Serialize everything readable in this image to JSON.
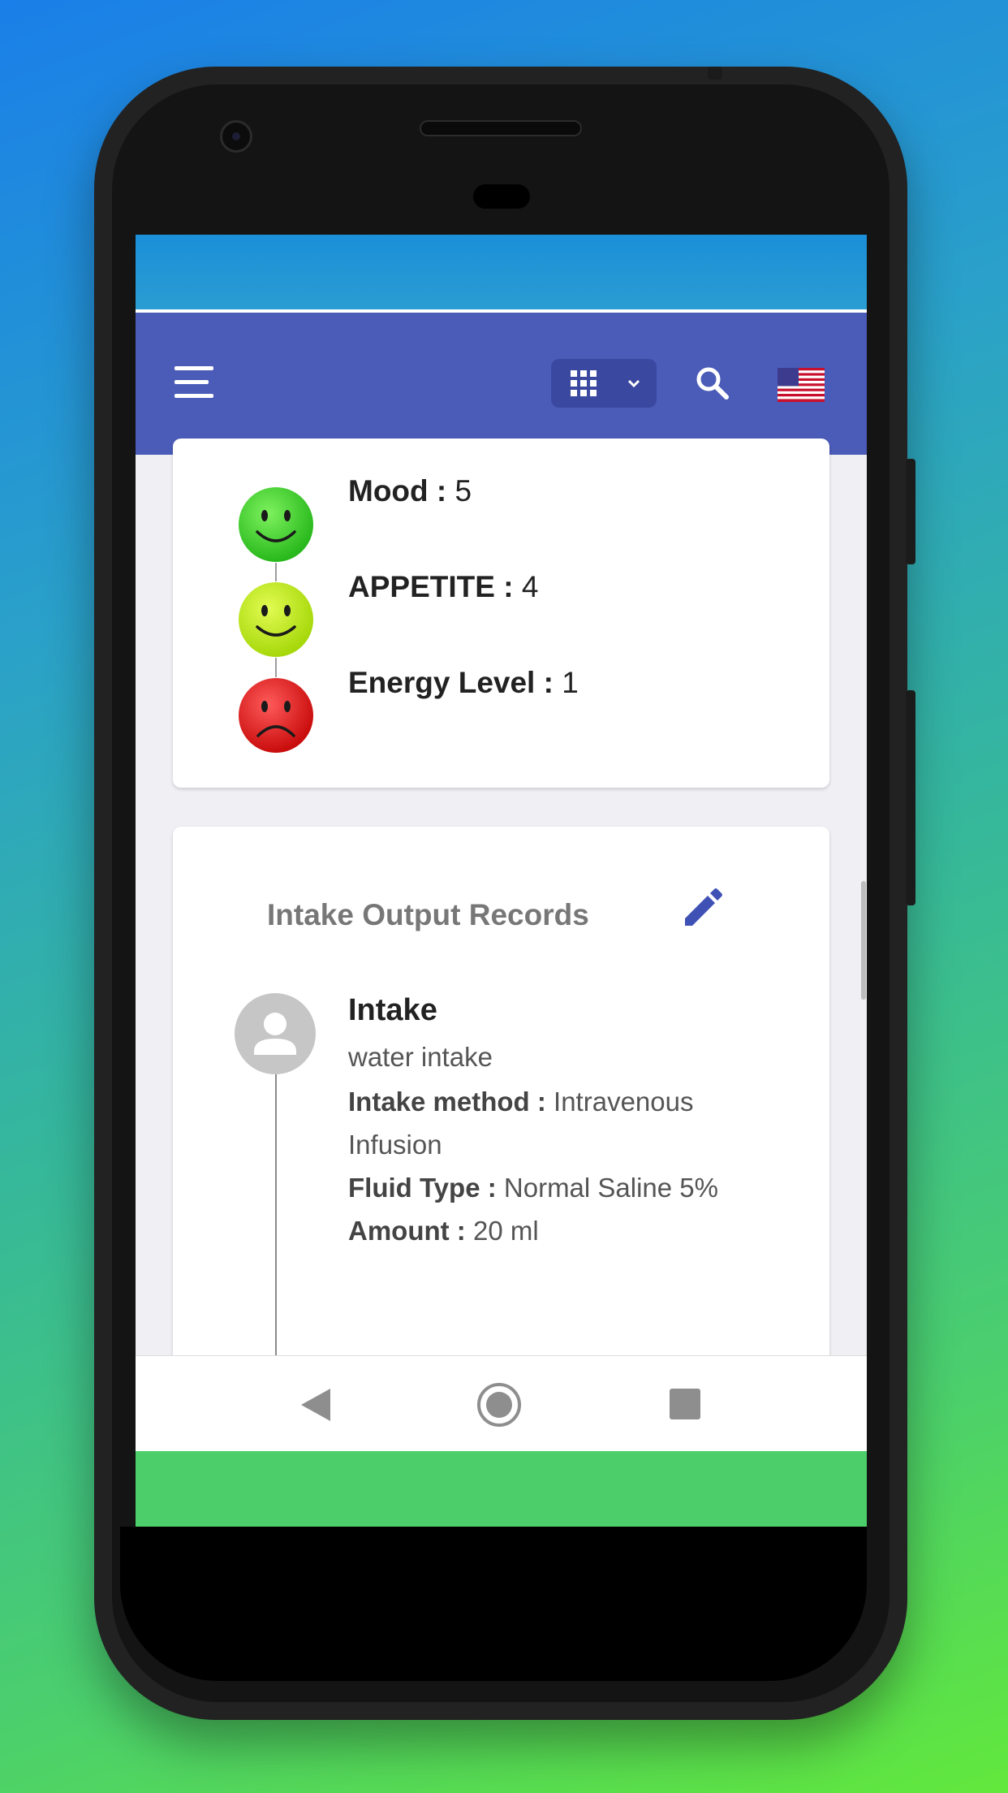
{
  "header": {
    "icons": [
      "menu-icon",
      "apps-grid-icon",
      "chevron-down-icon",
      "search-icon",
      "us-flag-icon"
    ]
  },
  "wellness": {
    "items": [
      {
        "label": "Mood :",
        "value": "5",
        "face": "happy",
        "color": "#3fd22a"
      },
      {
        "label": "APPETITE :",
        "value": "4",
        "face": "happy",
        "color": "#b9e812"
      },
      {
        "label": "Energy Level :",
        "value": "1",
        "face": "sad",
        "color": "#e21a1a"
      }
    ]
  },
  "records": {
    "title": "Intake Output Records",
    "entry": {
      "title": "Intake",
      "description": "water intake",
      "method_label": "Intake method :",
      "method_value": "Intravenous Infusion",
      "fluid_label": "Fluid Type :",
      "fluid_value": "Normal Saline 5%",
      "amount_label": "Amount :",
      "amount_value": "20 ml"
    }
  },
  "colors": {
    "appbar": "#4a5bb8",
    "accent": "#3f51b5"
  }
}
